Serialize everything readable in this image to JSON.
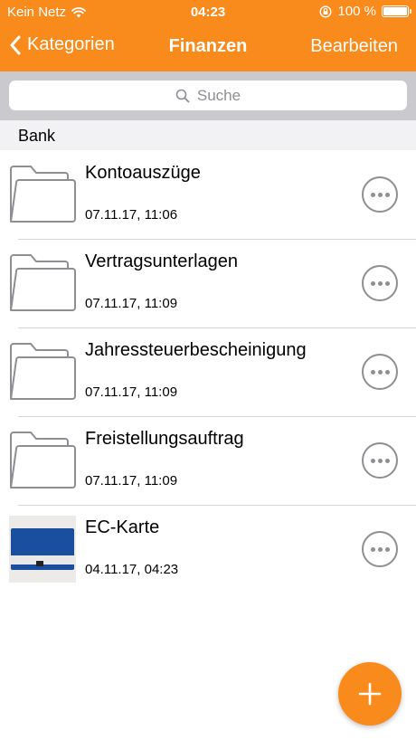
{
  "status_bar": {
    "carrier": "Kein Netz",
    "time": "04:23",
    "battery": "100 %",
    "icons": [
      "wifi-icon",
      "orientation-lock-icon",
      "battery-icon"
    ]
  },
  "nav": {
    "back_label": "Kategorien",
    "title": "Finanzen",
    "edit_label": "Bearbeiten"
  },
  "search": {
    "placeholder": "Suche"
  },
  "section": {
    "title": "Bank"
  },
  "items": [
    {
      "title": "Kontoauszüge",
      "date": "07.11.17, 11:06",
      "icon": "folder-icon"
    },
    {
      "title": "Vertragsunterlagen",
      "date": "07.11.17, 11:09",
      "icon": "folder-icon"
    },
    {
      "title": "Jahressteuerbescheinigung",
      "date": "07.11.17, 11:09",
      "icon": "folder-icon"
    },
    {
      "title": "Freistellungsauftrag",
      "date": "07.11.17, 11:09",
      "icon": "folder-icon"
    },
    {
      "title": "EC-Karte",
      "date": "04.11.17, 04:23",
      "icon": "card-photo-thumbnail"
    }
  ],
  "colors": {
    "accent": "#F98A1C",
    "search_bg": "#C9C9CE",
    "section_bg": "#F2F2F4",
    "icon_gray": "#8E8E93"
  }
}
